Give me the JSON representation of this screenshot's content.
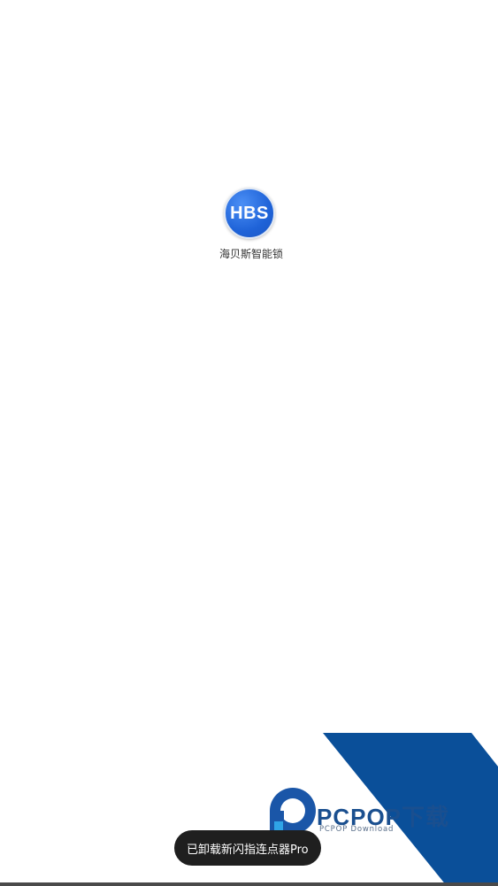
{
  "launcher": {
    "app_icon_text": "HBS",
    "app_label": "海贝斯智能锁"
  },
  "toast": {
    "message": "已卸载新闪指连点器Pro"
  },
  "watermark": {
    "brand": "PCPOP下载",
    "subtitle": "PCPOP Download"
  },
  "icons": {
    "app": "hbs-logo-icon",
    "watermark_logo": "pcpop-logo-icon"
  },
  "colors": {
    "app_icon_blue": "#1f63d8",
    "watermark_blue": "#0a4f99",
    "toast_bg": "#1f1f1f"
  }
}
